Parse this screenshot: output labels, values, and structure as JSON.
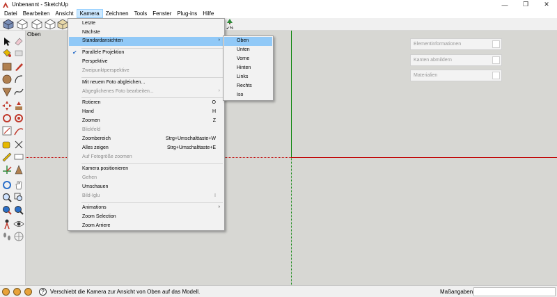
{
  "window": {
    "title": "Unbenannt - SketchUp"
  },
  "menubar": {
    "items": [
      "Datei",
      "Bearbeiten",
      "Ansicht",
      "Kamera",
      "Zeichnen",
      "Tools",
      "Fenster",
      "Plug-ins",
      "Hilfe"
    ]
  },
  "toolbar": {
    "zoom_badge": "↙%"
  },
  "canvas": {
    "view_label": "Oben"
  },
  "panels": [
    "Elementinformationen",
    "Kanten abmildern",
    "Materialien"
  ],
  "camera_menu": {
    "items": [
      {
        "label": "Letzte"
      },
      {
        "label": "Nächste"
      },
      {
        "label": "Standardansichten"
      },
      {
        "label": "Parallele Projektion"
      },
      {
        "label": "Perspektive"
      },
      {
        "label": "Zweipunktperspektive"
      },
      {
        "label": "Mit neuem Foto abgleichen..."
      },
      {
        "label": "Abgeglichenes Foto bearbeiten..."
      },
      {
        "label": "Rotieren",
        "shortcut": "O"
      },
      {
        "label": "Hand",
        "shortcut": "H"
      },
      {
        "label": "Zoomen",
        "shortcut": "Z"
      },
      {
        "label": "Blickfeld"
      },
      {
        "label": "Zoombereich",
        "shortcut": "Strg+Umschalttaste+W"
      },
      {
        "label": "Alles zeigen",
        "shortcut": "Strg+Umschalttaste+E"
      },
      {
        "label": "Auf Fotogröße zoomen"
      },
      {
        "label": "Kamera positionieren"
      },
      {
        "label": "Gehen"
      },
      {
        "label": "Umschauen"
      },
      {
        "label": "Bild-Iglu",
        "shortcut": "I"
      },
      {
        "label": "Animations"
      },
      {
        "label": "Zoom Selection"
      },
      {
        "label": "Zoom Arriere"
      }
    ]
  },
  "standard_views": [
    "Oben",
    "Unten",
    "Vorne",
    "Hinten",
    "Links",
    "Rechts",
    "Iso"
  ],
  "status": {
    "message": "Verschiebt die Kamera zur Ansicht von Oben auf das Modell.",
    "measurements_label": "Maßangaben",
    "measurements_value": ""
  }
}
